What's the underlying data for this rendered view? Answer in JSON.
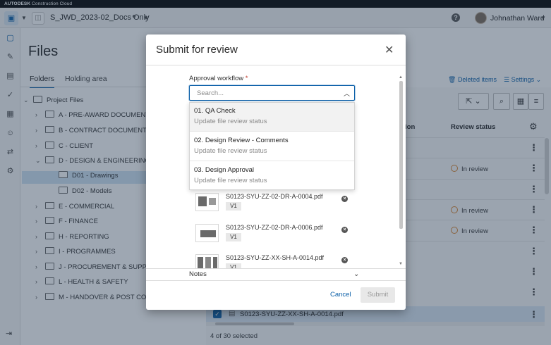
{
  "topbar": {
    "brand_bold": "AUTODESK",
    "brand_rest": " Construction Cloud"
  },
  "header": {
    "project_name": "S_JWD_2023-02_Docs Only",
    "user_name": "Johnathan Ward"
  },
  "page": {
    "title": "Files",
    "tabs": [
      {
        "label": "Folders"
      },
      {
        "label": "Holding area"
      }
    ],
    "deleted_items": "Deleted items",
    "settings": "Settings"
  },
  "tree": [
    {
      "label": "Project Files"
    },
    {
      "label": "A - PRE-AWARD DOCUMENTS"
    },
    {
      "label": "B - CONTRACT DOCUMENTATION"
    },
    {
      "label": "C - CLIENT"
    },
    {
      "label": "D - DESIGN & ENGINEERING"
    },
    {
      "label": "D01 - Drawings"
    },
    {
      "label": "D02 - Models"
    },
    {
      "label": "E - COMMERCIAL"
    },
    {
      "label": "F - FINANCE"
    },
    {
      "label": "H - REPORTING"
    },
    {
      "label": "I - PROGRAMMES"
    },
    {
      "label": "J - PROCUREMENT & SUPPLY CHAIN"
    },
    {
      "label": "L - HEALTH & SAFETY"
    },
    {
      "label": "M - HANDOVER & POST CONTRACT"
    }
  ],
  "table": {
    "col_partial": "ion",
    "col_review_status": "Review status",
    "status_in_review": "In review",
    "bottom_file": "S0123-SYU-ZZ-XX-SH-A-0014.pdf",
    "selected_count": "4 of 30 selected"
  },
  "modal": {
    "title": "Submit for review",
    "workflow_label": "Approval workflow",
    "required_mark": "*",
    "search_placeholder": "Search...",
    "options": [
      {
        "title": "01. QA Check",
        "subtitle": "Update file review status"
      },
      {
        "title": "02. Design Review - Comments",
        "subtitle": "Update file review status"
      },
      {
        "title": "03. Design Approval",
        "subtitle": "Update file review status"
      }
    ],
    "files": [
      {
        "name": "S0123-SYU-ZZ-02-DR-A-0004.pdf",
        "version": "V1"
      },
      {
        "name": "S0123-SYU-ZZ-02-DR-A-0006.pdf",
        "version": "V1"
      },
      {
        "name": "S0123-SYU-ZZ-XX-SH-A-0014.pdf",
        "version": "V1"
      }
    ],
    "notes_label": "Notes",
    "cancel": "Cancel",
    "submit": "Submit"
  }
}
